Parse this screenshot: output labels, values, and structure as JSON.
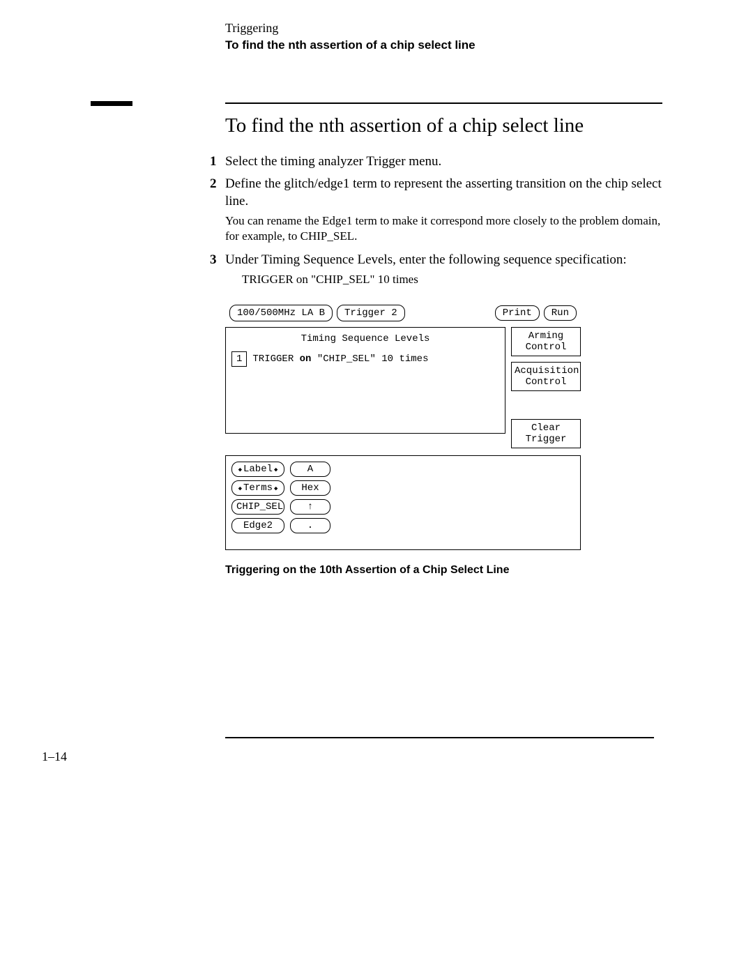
{
  "header": {
    "breadcrumb": "Triggering",
    "subtitle": "To find the nth assertion of a chip select line"
  },
  "section": {
    "title": "To find the nth assertion of a chip select line"
  },
  "steps": [
    {
      "num": "1",
      "body": "Select the timing analyzer Trigger menu."
    },
    {
      "num": "2",
      "body": "Define the glitch/edge1 term to represent the asserting transition on the chip select line.",
      "note": "You can rename the Edge1 term to make it correspond more closely to the problem domain, for example, to CHIP_SEL."
    },
    {
      "num": "3",
      "body": "Under Timing Sequence Levels, enter the following sequence specification:",
      "spec": "TRIGGER on \"CHIP_SEL\" 10 times"
    }
  ],
  "figure": {
    "toolbar": {
      "mode": "100/500MHz LA B",
      "menu": "Trigger 2",
      "print": "Print",
      "run": "Run"
    },
    "seq_panel": {
      "title": "Timing Sequence Levels",
      "level_num": "1",
      "level_text_prefix": "TRIGGER ",
      "level_text_bold": "on",
      "level_text_rest": " \"CHIP_SEL\"  10 times"
    },
    "side_buttons": {
      "arming": "Arming\nControl",
      "acq": "Acquisition\nControl",
      "clear": "Clear\nTrigger"
    },
    "bottom": {
      "rows": [
        {
          "k": "Label",
          "v": "A",
          "arrows": true
        },
        {
          "k": "Terms",
          "v": "Hex",
          "arrows": true
        },
        {
          "k": "CHIP_SEL",
          "v": "↑",
          "arrows": false
        },
        {
          "k": "Edge2",
          "v": ".",
          "arrows": false
        }
      ]
    },
    "caption": "Triggering on the 10th Assertion of a Chip Select Line"
  },
  "page_number": "1–14"
}
